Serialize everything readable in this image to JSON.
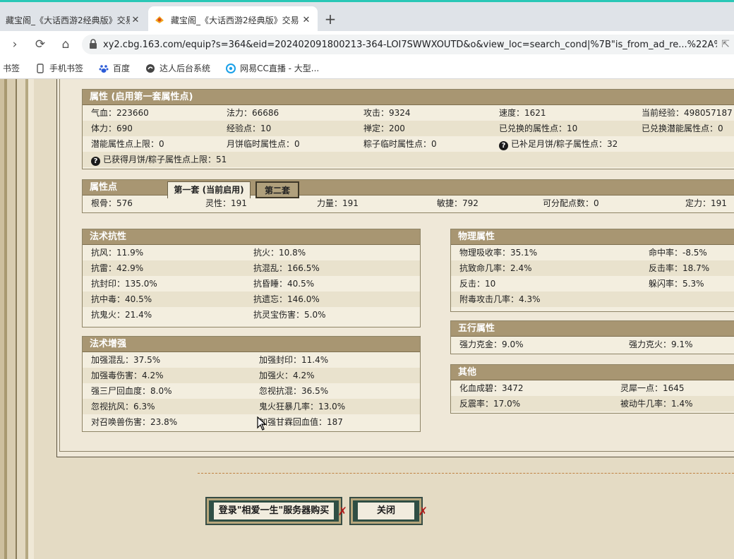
{
  "browser": {
    "tabs": [
      {
        "title": "藏宝阁_《大话西游2经典版》交易",
        "active": false
      },
      {
        "title": "藏宝阁_《大话西游2经典版》交易",
        "active": true
      }
    ],
    "new_tab": "+",
    "url": "xy2.cbg.163.com/equip?s=364&eid=202402091800213-364-LOI7SWWXOUTD&o&view_loc=search_cond|%7B\"is_from_ad_re...%22A%20%20%3...",
    "bookmarks": [
      "书签",
      "手机书签",
      "百度",
      "达人后台系统",
      "网易CC直播 - 大型..."
    ]
  },
  "attributes": {
    "title": "属性 (启用第一套属性点)",
    "rows": [
      [
        "气血：223660",
        "法力：66686",
        "攻击：9324",
        "速度：1621",
        "当前经验：498057187"
      ],
      [
        "体力：690",
        "经验点：10",
        "禅定：200",
        "已兑换的属性点：10",
        "已兑换潜能属性点：0"
      ],
      [
        "潜能属性点上限：0",
        "月饼临时属性点：0",
        "粽子临时属性点：0",
        "已补足月饼/粽子属性点：32"
      ],
      [
        "已获得月饼/粽子属性点上限：51"
      ]
    ]
  },
  "points": {
    "title": "属性点",
    "tab1": "第一套 (当前启用)",
    "tab2": "第二套",
    "values": [
      "根骨：576",
      "灵性：191",
      "力量：191",
      "敏捷：792",
      "可分配点数：0",
      "定力：191"
    ]
  },
  "resist": {
    "title": "法术抗性",
    "rows": [
      [
        "抗风：11.9%",
        "抗火：10.8%"
      ],
      [
        "抗雷：42.9%",
        "抗混乱：166.5%"
      ],
      [
        "抗封印：135.0%",
        "抗昏睡：40.5%"
      ],
      [
        "抗中毒：40.5%",
        "抗遗忘：146.0%"
      ],
      [
        "抗鬼火：21.4%",
        "抗灵宝伤害：5.0%"
      ]
    ]
  },
  "enhance": {
    "title": "法术增强",
    "rows": [
      [
        "加强混乱：37.5%",
        "加强封印：11.4%"
      ],
      [
        "加强毒伤害：4.2%",
        "加强火：4.2%"
      ],
      [
        "强三尸回血度：8.0%",
        "忽视抗混：36.5%"
      ],
      [
        "忽视抗风：6.3%",
        "鬼火狂暴几率：13.0%"
      ],
      [
        "对召唤兽伤害：23.8%",
        "加强甘霖回血值：187"
      ]
    ]
  },
  "physical": {
    "title": "物理属性",
    "rows": [
      [
        "物理吸收率：35.1%",
        "命中率：-8.5%"
      ],
      [
        "抗致命几率：2.4%",
        "反击率：18.7%"
      ],
      [
        "反击：10",
        "躲闪率：5.3%"
      ],
      [
        "附毒攻击几率：4.3%",
        ""
      ]
    ]
  },
  "wuxing": {
    "title": "五行属性",
    "rows": [
      [
        "强力克金：9.0%",
        "强力克火：9.1%"
      ]
    ]
  },
  "other": {
    "title": "其他",
    "rows": [
      [
        "化血成碧：3472",
        "灵犀一点：1645"
      ],
      [
        "反震率：17.0%",
        "被动牛几率：1.4%"
      ]
    ]
  },
  "buttons": {
    "login": "登录\"相爱一生\"服务器购买",
    "close": "关闭"
  }
}
